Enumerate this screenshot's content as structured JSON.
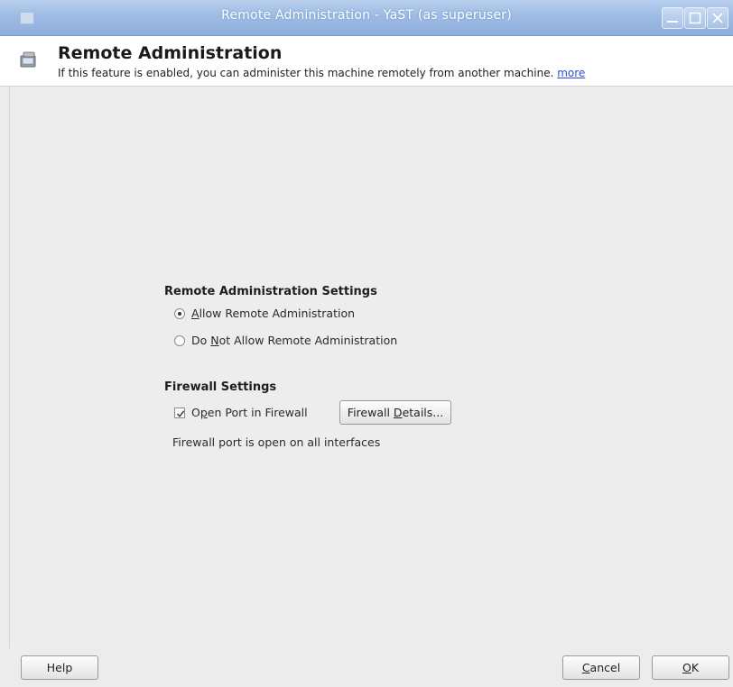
{
  "window": {
    "title": "Remote Administration - YaST (as superuser)"
  },
  "header": {
    "title": "Remote Administration",
    "description": "If this feature is enabled, you can administer this machine remotely from another machine.",
    "more_link": "more"
  },
  "remote_admin": {
    "section_title": "Remote Administration Settings",
    "allow": {
      "prefix": "",
      "mnemonic": "A",
      "rest": "llow Remote Administration",
      "selected": true
    },
    "deny": {
      "prefix": "Do ",
      "mnemonic": "N",
      "rest": "ot Allow Remote Administration",
      "selected": false
    }
  },
  "firewall": {
    "section_title": "Firewall Settings",
    "open_port": {
      "prefix": "O",
      "mnemonic": "p",
      "rest": "en Port in Firewall",
      "checked": true
    },
    "details_button": {
      "prefix": "Firewall ",
      "mnemonic": "D",
      "rest": "etails..."
    },
    "status": "Firewall port is open on all interfaces"
  },
  "buttons": {
    "help": "Help",
    "cancel": {
      "mnemonic": "C",
      "rest": "ancel"
    },
    "ok": {
      "mnemonic": "O",
      "rest": "K"
    }
  },
  "icons": {
    "header": "remote-admin-icon",
    "window": "yast-window-icon"
  }
}
